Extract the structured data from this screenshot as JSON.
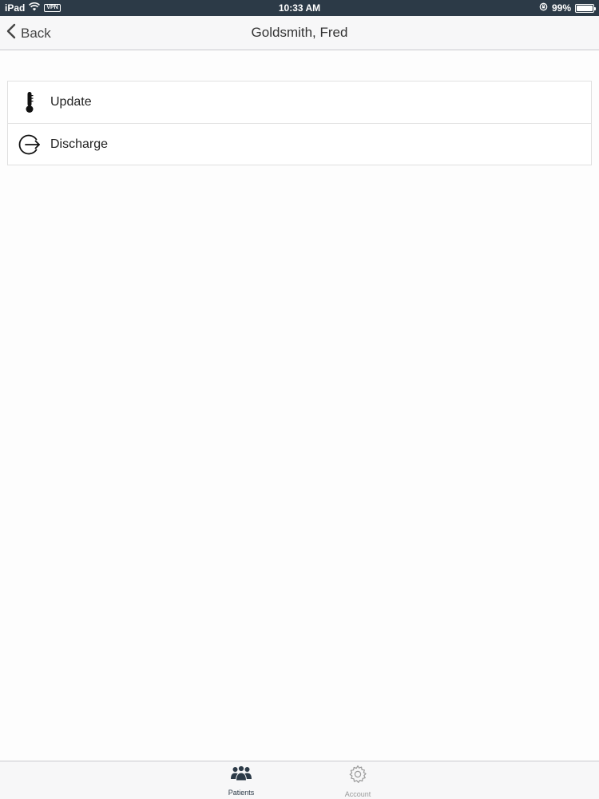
{
  "status_bar": {
    "device": "iPad",
    "vpn": "VPN",
    "time": "10:33 AM",
    "battery": "99%",
    "battery_level": 0.99,
    "icons": [
      "wifi-icon",
      "lock-rotation-icon",
      "battery-icon"
    ]
  },
  "nav": {
    "back_label": "Back",
    "title": "Goldsmith, Fred"
  },
  "actions": [
    {
      "label": "Update",
      "icon": "thermometer-icon"
    },
    {
      "label": "Discharge",
      "icon": "exit-arrow-icon"
    }
  ],
  "tabs": [
    {
      "label": "Patients",
      "icon": "people-icon",
      "active": true
    },
    {
      "label": "Account",
      "icon": "gear-icon",
      "active": false
    }
  ],
  "colors": {
    "status_bar": "#2c3a47",
    "nav_bg": "#f7f7f8",
    "active_tab": "#2c3a47",
    "inactive_tab": "#999999"
  }
}
